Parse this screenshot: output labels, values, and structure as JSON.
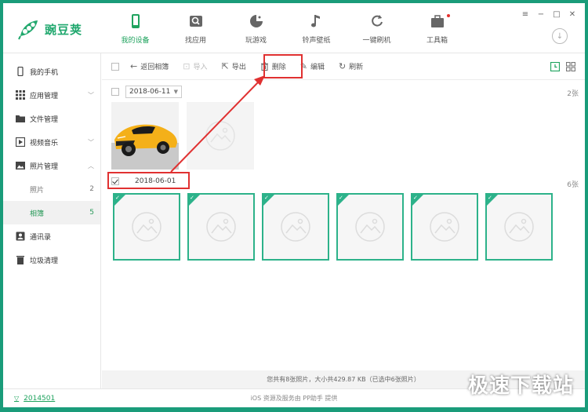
{
  "app": {
    "name": "豌豆荚"
  },
  "nav": {
    "items": [
      {
        "label": "我的设备",
        "icon": "phone-icon",
        "active": true
      },
      {
        "label": "找应用",
        "icon": "search-app-icon"
      },
      {
        "label": "玩游戏",
        "icon": "game-icon"
      },
      {
        "label": "铃声壁纸",
        "icon": "music-icon"
      },
      {
        "label": "一键刷机",
        "icon": "refresh-icon"
      },
      {
        "label": "工具箱",
        "icon": "toolbox-icon"
      }
    ]
  },
  "window": {
    "menu": "≡",
    "minimize": "−",
    "maximize": "□",
    "close": "✕"
  },
  "sidebar": {
    "items": [
      {
        "label": "我的手机",
        "icon": "phone-icon"
      },
      {
        "label": "应用管理",
        "icon": "grid-icon",
        "chevron": "﹀"
      },
      {
        "label": "文件管理",
        "icon": "folder-icon"
      },
      {
        "label": "视频音乐",
        "icon": "video-icon",
        "chevron": "﹀"
      },
      {
        "label": "照片管理",
        "icon": "photo-icon",
        "chevron": "︿"
      }
    ],
    "sub": [
      {
        "label": "照片",
        "count": "2"
      },
      {
        "label": "相簿",
        "count": "5",
        "active": true
      }
    ],
    "bottom": [
      {
        "label": "通讯录",
        "icon": "contacts-icon"
      },
      {
        "label": "垃圾清理",
        "icon": "trash-icon"
      }
    ]
  },
  "toolbar": {
    "back": "返回相簿",
    "import": "导入",
    "export": "导出",
    "delete": "删除",
    "edit": "编辑",
    "refresh": "刷新"
  },
  "groups": [
    {
      "date": "2018-06-11",
      "count": "2张"
    },
    {
      "date": "2018-06-01",
      "count": "6张"
    }
  ],
  "status": {
    "text": "您共有8张照片，大小共429.87 KB（已选中6张照片）"
  },
  "footer": {
    "version": "2014501",
    "note": "iOS 资源及服务由 PP助手 提供"
  },
  "watermark": "极速下载站",
  "colors": {
    "brand": "#1fa35e",
    "accent": "#2db28a",
    "annotation": "#e03131",
    "frame": "#1a9c7a"
  }
}
